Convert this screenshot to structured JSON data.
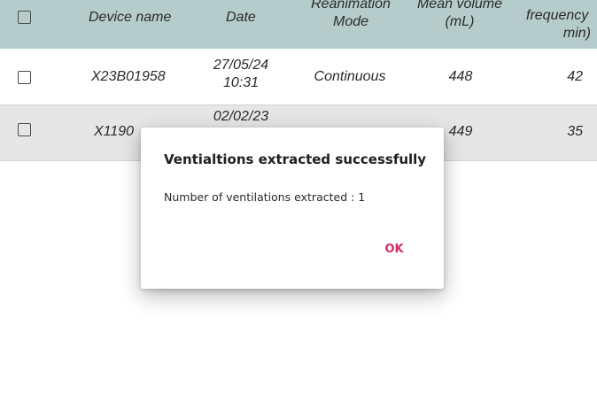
{
  "table": {
    "headers": {
      "device_name": "Device name",
      "date": "Date",
      "reanimation_mode_line1": "Reanimation",
      "reanimation_mode_line2": "Mode",
      "mean_volume_line1": "Mean volume",
      "mean_volume_line2": "(mL)",
      "frequency_line1": "frequency",
      "frequency_line2": "min)"
    },
    "rows": [
      {
        "device_name": "X23B01958",
        "date_line1": "27/05/24",
        "date_line2": "10:31",
        "mode": "Continuous",
        "mean_volume": "448",
        "frequency": "42",
        "checked": false
      },
      {
        "device_name": "X1190",
        "date_line1": "02/02/23",
        "mean_volume": "449",
        "frequency": "35",
        "checked": false
      }
    ]
  },
  "dialog": {
    "title": "Ventialtions extracted successfully",
    "message": "Number of ventilations extracted : 1",
    "ok_label": "OK",
    "ok_color": "#d12a6a"
  },
  "colors": {
    "header_bg": "#b5cccb",
    "row_alt_bg": "#e6e6e6"
  }
}
